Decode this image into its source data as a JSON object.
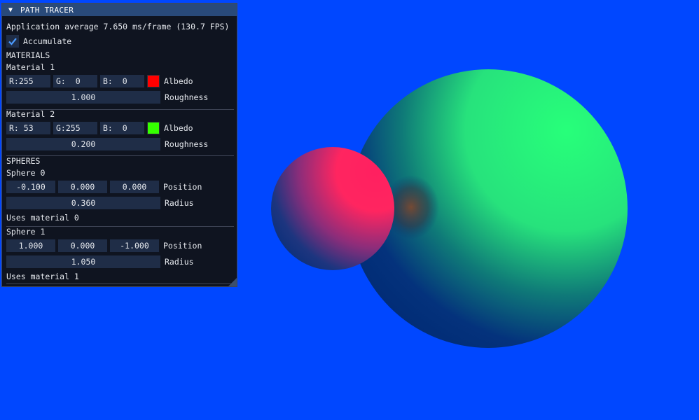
{
  "window": {
    "title": "PATH TRACER",
    "collapse_icon": "▼",
    "stats": "Application average 7.650 ms/frame (130.7 FPS)",
    "accumulate_label": "Accumulate",
    "accumulate_checked": true
  },
  "materials": {
    "header": "MATERIALS",
    "items": [
      {
        "name": "Material 1",
        "r": "R:255",
        "g": "G:  0",
        "b": "B:  0",
        "swatch_color": "#ff0000",
        "albedo_label": "Albedo",
        "roughness": "1.000",
        "roughness_label": "Roughness"
      },
      {
        "name": "Material 2",
        "r": "R: 53",
        "g": "G:255",
        "b": "B:  0",
        "swatch_color": "#35ff00",
        "albedo_label": "Albedo",
        "roughness": "0.200",
        "roughness_label": "Roughness"
      }
    ]
  },
  "spheres": {
    "header": "SPHERES",
    "items": [
      {
        "name": "Sphere 0",
        "pos": [
          "-0.100",
          "0.000",
          "0.000"
        ],
        "position_label": "Position",
        "radius": "0.360",
        "radius_label": "Radius",
        "uses": "Uses material 0"
      },
      {
        "name": "Sphere 1",
        "pos": [
          "1.000",
          "0.000",
          "-1.000"
        ],
        "position_label": "Position",
        "radius": "1.050",
        "radius_label": "Radius",
        "uses": "Uses material 1"
      }
    ]
  },
  "scene": {
    "background_color": "#0047ff",
    "sphere0_color": "#ff2060",
    "sphere1_color": "#22ff77"
  }
}
